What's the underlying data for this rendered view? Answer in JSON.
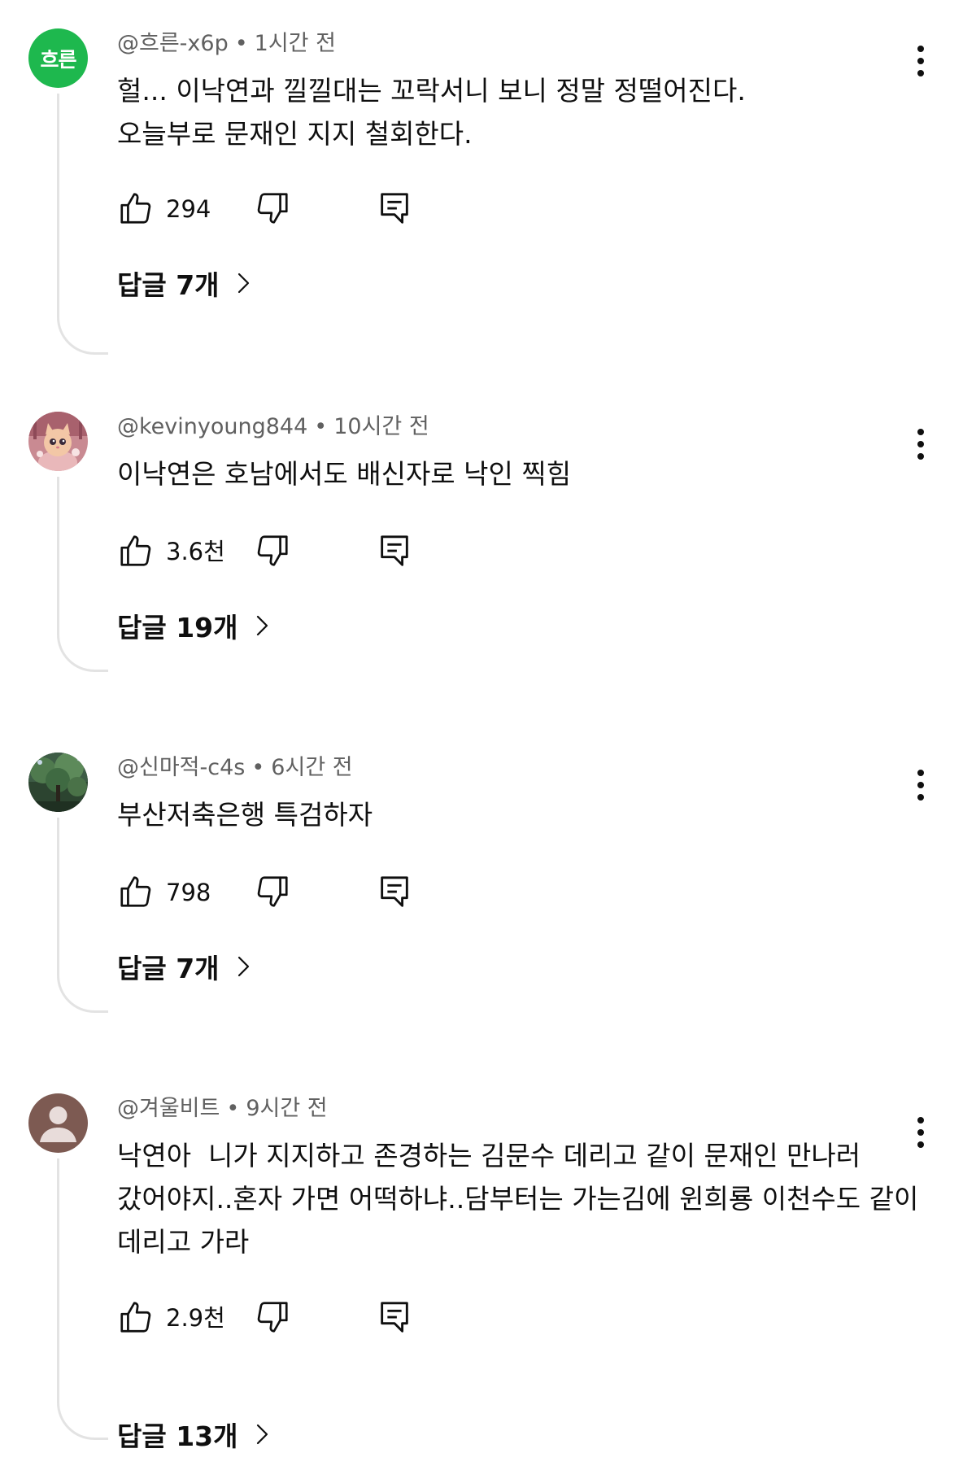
{
  "comments": [
    {
      "author": "@흐른-x6p",
      "time": "1시간 전",
      "avatar_text": "흐른",
      "avatar_color": "#1eb84e",
      "text": "헐... 이낙연과 낄낄대는 꼬락서니 보니 정말 정떨어진다.\n오늘부로 문재인 지지 철회한다.",
      "likes": "294",
      "replies_label": "답글 7개"
    },
    {
      "author": "@kevinyoung844",
      "time": "10시간 전",
      "avatar_icon": "cat-avatar-icon",
      "text": "이낙연은 호남에서도 배신자로 낙인 찍힘",
      "likes": "3.6천",
      "replies_label": "답글 19개"
    },
    {
      "author": "@신마적-c4s",
      "time": "6시간 전",
      "avatar_icon": "tree-avatar-icon",
      "text": "부산저축은행 특검하자",
      "likes": "798",
      "replies_label": "답글 7개"
    },
    {
      "author": "@겨울비트",
      "time": "9시간 전",
      "avatar_icon": "default-user-avatar-icon",
      "text": "낙연아  니가 지지하고 존경하는 김문수 데리고 같이 문재인 만나러 갔어야지..혼자 가면 어떡하냐..담부터는 가는김에 윈희룡 이천수도 같이 데리고 가라",
      "likes": "2.9천",
      "replies_label": "답글 13개"
    }
  ],
  "separator": "•",
  "icons": {
    "like": "thumbs-up-icon",
    "dislike": "thumbs-down-icon",
    "reply": "reply-comment-icon",
    "more": "more-vertical-icon",
    "chevron": "chevron-right-icon"
  },
  "colors": {
    "text_primary": "#0f0f0f",
    "text_secondary": "#606060",
    "thread_line": "#e3e3e3"
  }
}
